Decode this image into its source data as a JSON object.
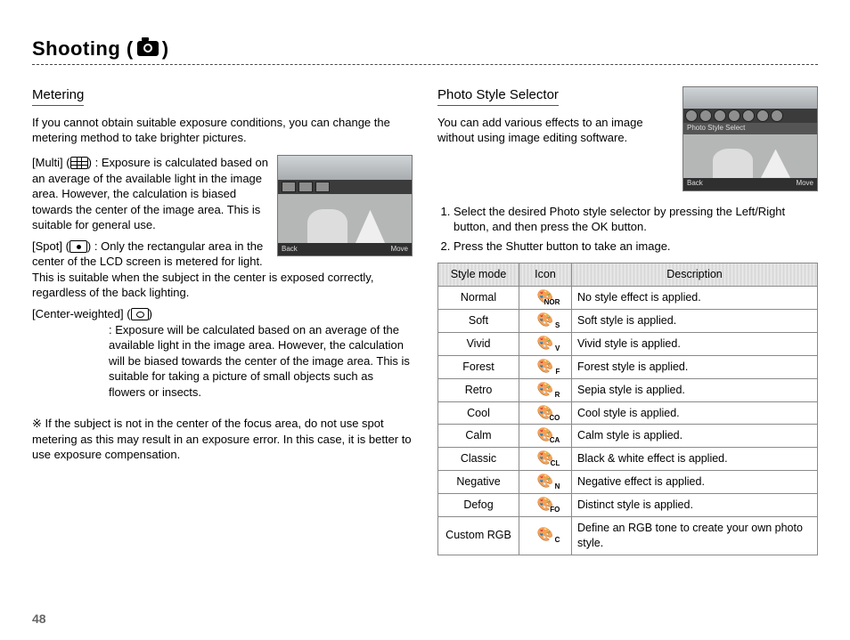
{
  "chapter_title": "Shooting (",
  "chapter_title_suffix": " )",
  "page_number": "48",
  "metering": {
    "heading": "Metering",
    "intro": "If you cannot obtain suitable exposure conditions, you can change the metering method to take brighter pictures.",
    "items": [
      {
        "term": "[Multi] (",
        "term_suffix": ") :",
        "desc": "Exposure is calculated based on an average of the available light in the image area. However, the calculation is biased towards the center of the image area. This is suitable for general use."
      },
      {
        "term": "[Spot] (",
        "term_suffix": ") :",
        "desc": "Only the rectangular area in the center of the LCD screen is metered for light. This is suitable when the subject in the center is exposed correctly, regardless of the back lighting."
      },
      {
        "term": "[Center-weighted] (",
        "term_suffix": ")",
        "desc": ": Exposure will be calculated based on an average of the available light in the image area. However, the calculation will be biased towards the center of the image area. This is suitable for taking a picture of small objects such as flowers or insects."
      }
    ],
    "note": "※ If the subject is not in the center of the focus area, do not use spot metering as this may result in an exposure error. In this case, it is better to use exposure compensation.",
    "thumb": {
      "back": "Back",
      "move": "Move"
    }
  },
  "pss": {
    "heading": "Photo Style Selector",
    "intro": "You can add various effects to an image without using image editing software.",
    "thumb": {
      "label": "Photo Style Select",
      "back": "Back",
      "move": "Move"
    },
    "steps": [
      "Select the desired Photo style selector by pressing the Left/Right button, and then press the OK button.",
      "Press the Shutter button to take an image."
    ],
    "table": {
      "headers": {
        "mode": "Style mode",
        "icon": "Icon",
        "desc": "Description"
      },
      "rows": [
        {
          "mode": "Normal",
          "sub": "NOR",
          "desc": "No style effect is applied."
        },
        {
          "mode": "Soft",
          "sub": "S",
          "desc": "Soft style is applied."
        },
        {
          "mode": "Vivid",
          "sub": "V",
          "desc": "Vivid style is applied."
        },
        {
          "mode": "Forest",
          "sub": "F",
          "desc": "Forest style is applied."
        },
        {
          "mode": "Retro",
          "sub": "R",
          "desc": "Sepia style is applied."
        },
        {
          "mode": "Cool",
          "sub": "CO",
          "desc": "Cool style is applied."
        },
        {
          "mode": "Calm",
          "sub": "CA",
          "desc": "Calm style is applied."
        },
        {
          "mode": "Classic",
          "sub": "CL",
          "desc": "Black & white effect is applied."
        },
        {
          "mode": "Negative",
          "sub": "N",
          "desc": "Negative effect is applied."
        },
        {
          "mode": "Defog",
          "sub": "FO",
          "desc": "Distinct style is applied."
        },
        {
          "mode": "Custom RGB",
          "sub": "C",
          "desc": "Define an RGB tone to create your own photo style."
        }
      ]
    }
  }
}
